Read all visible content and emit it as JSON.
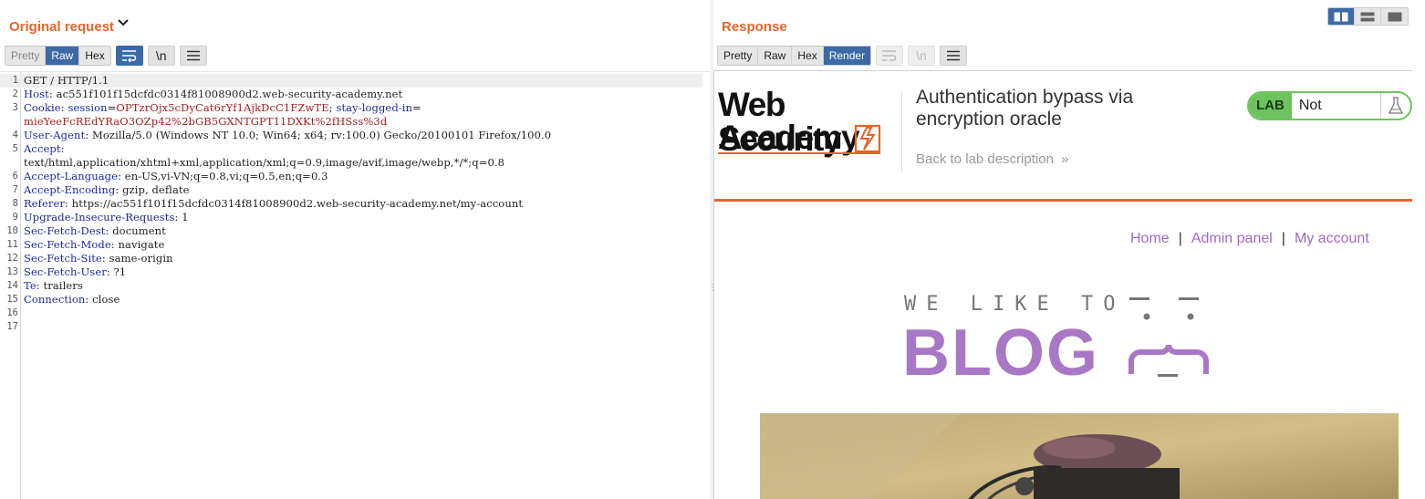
{
  "left_pane": {
    "title": "Original request",
    "view_tabs": [
      "Pretty",
      "Raw",
      "Hex"
    ],
    "active_tab": "Raw",
    "request_lines": [
      {
        "num": "1",
        "key": "",
        "sep": "",
        "val": "",
        "plain": "GET / HTTP/1.1"
      },
      {
        "num": "2",
        "key": "Host",
        "sep": ": ",
        "val": "",
        "plain": "ac551f101f15dcfdc0314f81008900d2.web-security-academy.net"
      },
      {
        "num": "3",
        "key": "Cookie",
        "sep": ": ",
        "cookie": true,
        "k1": "session",
        "v1": "OPTzrOjx5cDyCat6rYf1AjkDcC1FZwTE",
        "k2": "stay-logged-in"
      },
      {
        "num": "",
        "key": "",
        "sep": "",
        "val": "mieYeeFcREdYRaO3OZp42%2bGB5GXNTGPT11DXKt%2fHSss%3d",
        "plain": ""
      },
      {
        "num": "4",
        "key": "User-Agent",
        "sep": ": ",
        "val": "",
        "plain": "Mozilla/5.0 (Windows NT 10.0; Win64; x64; rv:100.0) Gecko/20100101 Firefox/100.0"
      },
      {
        "num": "5",
        "key": "Accept",
        "sep": ":",
        "val": "",
        "plain": ""
      },
      {
        "num": "",
        "key": "",
        "sep": "",
        "val": "",
        "plain": "text/html,application/xhtml+xml,application/xml;q=0.9,image/avif,image/webp,*/*;q=0.8"
      },
      {
        "num": "6",
        "key": "Accept-Language",
        "sep": ": ",
        "val": "",
        "plain": "en-US,vi-VN;q=0.8,vi;q=0.5,en;q=0.3"
      },
      {
        "num": "7",
        "key": "Accept-Encoding",
        "sep": ": ",
        "val": "",
        "plain": "gzip, deflate"
      },
      {
        "num": "8",
        "key": "Referer",
        "sep": ": ",
        "val": "",
        "plain": "https://ac551f101f15dcfdc0314f81008900d2.web-security-academy.net/my-account"
      },
      {
        "num": "9",
        "key": "Upgrade-Insecure-Requests",
        "sep": ": ",
        "val": "",
        "plain": "1"
      },
      {
        "num": "10",
        "key": "Sec-Fetch-Dest",
        "sep": ": ",
        "val": "",
        "plain": "document"
      },
      {
        "num": "11",
        "key": "Sec-Fetch-Mode",
        "sep": ": ",
        "val": "",
        "plain": "navigate"
      },
      {
        "num": "12",
        "key": "Sec-Fetch-Site",
        "sep": ": ",
        "val": "",
        "plain": "same-origin"
      },
      {
        "num": "13",
        "key": "Sec-Fetch-User",
        "sep": ": ",
        "val": "",
        "plain": "?1"
      },
      {
        "num": "14",
        "key": "Te",
        "sep": ": ",
        "val": "",
        "plain": "trailers"
      },
      {
        "num": "15",
        "key": "Connection",
        "sep": ": ",
        "val": "",
        "plain": "close"
      },
      {
        "num": "16",
        "key": "",
        "sep": "",
        "val": "",
        "plain": ""
      },
      {
        "num": "17",
        "key": "",
        "sep": "",
        "val": "",
        "plain": ""
      }
    ],
    "icons": [
      "wrap-icon",
      "newline-icon",
      "menu-icon"
    ],
    "newline_glyph": "\\n"
  },
  "right_pane": {
    "title": "Response",
    "view_tabs": [
      "Pretty",
      "Raw",
      "Hex",
      "Render"
    ],
    "active_tab": "Render",
    "newline_glyph": "\\n"
  },
  "rendered_page": {
    "logo_line1": "Web Security",
    "logo_line2": "Academy",
    "lab_title": "Authentication bypass via encryption oracle",
    "back_link": "Back to lab description",
    "back_chevrons": "»",
    "lab_badge": "LAB",
    "lab_status": "Not solved",
    "nav": {
      "home": "Home",
      "admin": "Admin panel",
      "account": "My account",
      "separator": "|"
    },
    "blog_tagline": "WE LIKE TO",
    "blog_word": "BLOG"
  },
  "colors": {
    "accent_orange": "#e8642a",
    "active_blue": "#3b6aa7",
    "link_purple": "#a06bc3",
    "lab_green": "#6dc35e",
    "header_key_blue": "#1a2aa0",
    "cookie_value_red": "#a62020"
  }
}
